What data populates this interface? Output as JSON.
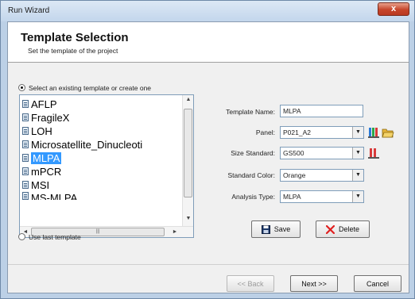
{
  "window": {
    "title": "Run Wizard",
    "close_label": "x"
  },
  "header": {
    "title": "Template Selection",
    "subtitle": "Set the template of the project"
  },
  "options": {
    "select_existing": "Select an existing template or create one",
    "use_last": "Use last template"
  },
  "templates": {
    "items": [
      "AFLP",
      "FragileX",
      "LOH",
      "Microsatellite_Dinucleoti",
      "MLPA",
      "mPCR",
      "MSI",
      "MS-MLPA"
    ],
    "selected": "MLPA"
  },
  "form": {
    "template_name_label": "Template Name:",
    "template_name_value": "MLPA",
    "panel_label": "Panel:",
    "panel_value": "P021_A2",
    "size_standard_label": "Size Standard:",
    "size_standard_value": "GS500",
    "standard_color_label": "Standard Color:",
    "standard_color_value": "Orange",
    "analysis_type_label": "Analysis Type:",
    "analysis_type_value": "MLPA"
  },
  "actions": {
    "save_label": "Save",
    "delete_label": "Delete"
  },
  "footer": {
    "back_label": "<< Back",
    "next_label": "Next >>",
    "cancel_label": "Cancel"
  },
  "colors": {
    "selection": "#3399ff",
    "delete_x": "#e02020",
    "window_frame": "#bcd0e6"
  }
}
